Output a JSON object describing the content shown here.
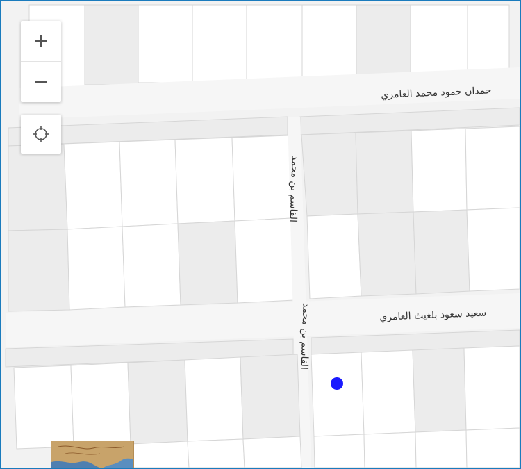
{
  "map": {
    "controls": {
      "zoom_in": "+",
      "zoom_out": "−"
    },
    "streets": [
      "حمدان حمود محمد العامري",
      "القاسم بن محمد",
      "القاسم بن محمد",
      "سعيد سعود بلغيث العامري"
    ],
    "icons": [
      "zoom-in-icon",
      "zoom-out-icon",
      "locate-icon",
      "location-marker"
    ],
    "colors": {
      "background": "#f2f2f2",
      "parcel_light": "#ffffff",
      "parcel_dark": "#ececec",
      "border": "#1a7bbd",
      "marker": "#1a1aff"
    }
  }
}
